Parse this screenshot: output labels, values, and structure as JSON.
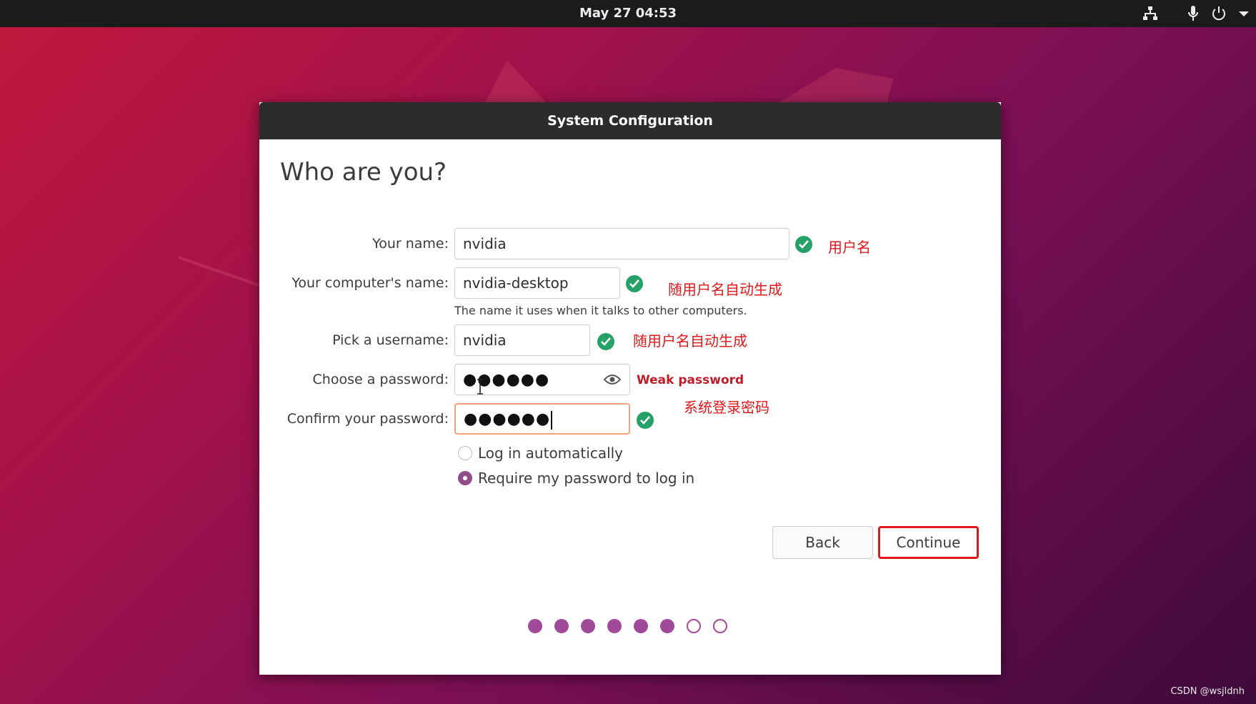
{
  "topbar": {
    "datetime": "May 27  04:53",
    "icons": [
      "network-icon",
      "microphone-icon",
      "power-icon",
      "chevron-down-icon"
    ]
  },
  "window": {
    "title": "System Configuration",
    "heading": "Who are you?",
    "fields": {
      "name": {
        "label": "Your name:",
        "value": "nvidia",
        "valid": true
      },
      "computer": {
        "label": "Your computer's name:",
        "value": "nvidia-desktop",
        "valid": true,
        "hint": "The name it uses when it talks to other computers."
      },
      "username": {
        "label": "Pick a username:",
        "value": "nvidia",
        "valid": true
      },
      "password": {
        "label": "Choose a password:",
        "value": "●●●●●●",
        "strength": "Weak password"
      },
      "confirm": {
        "label": "Confirm your password:",
        "value": "●●●●●●",
        "valid": true
      }
    },
    "login_options": [
      {
        "label": "Log in automatically",
        "selected": false
      },
      {
        "label": "Require my password to log in",
        "selected": true
      }
    ],
    "buttons": {
      "back": "Back",
      "continue": "Continue"
    },
    "progress": {
      "completed": 6,
      "total": 8
    }
  },
  "annotations": {
    "name_note": "用户名",
    "computer_note": "随用户名自动生成",
    "username_note": "随用户名自动生成",
    "password_note": "系统登录密码"
  },
  "colors": {
    "accent": "#924d8b",
    "valid_check": "#26a269",
    "annotation_red": "#e0181b",
    "weak_password": "#c01c28"
  },
  "watermark": "CSDN @wsjldnh"
}
